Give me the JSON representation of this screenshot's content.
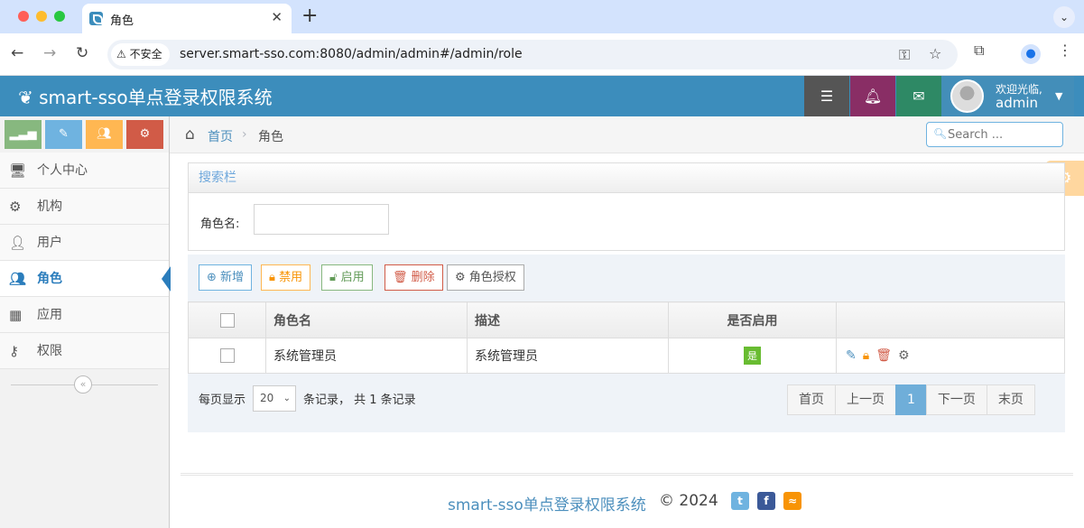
{
  "browser": {
    "tab_title": "角色",
    "tab_close": "✕",
    "new_tab": "+",
    "security_label": "不安全",
    "url": "server.smart-sso.com:8080/admin/admin#/admin/role"
  },
  "header": {
    "brand": "smart-sso单点登录权限系统",
    "welcome": "欢迎光临,",
    "username": "admin"
  },
  "sidebar": {
    "items": [
      {
        "label": "个人中心",
        "icon": "desktop-icon"
      },
      {
        "label": "机构",
        "icon": "gears-icon"
      },
      {
        "label": "用户",
        "icon": "user-icon"
      },
      {
        "label": "角色",
        "icon": "users-icon"
      },
      {
        "label": "应用",
        "icon": "th-large-icon"
      },
      {
        "label": "权限",
        "icon": "key-icon"
      }
    ],
    "active": "角色"
  },
  "breadcrumb": {
    "home": "首页",
    "current": "角色"
  },
  "search": {
    "placeholder": "Search ..."
  },
  "search_panel": {
    "title": "搜索栏",
    "role_name_label": "角色名:"
  },
  "actions": {
    "add": "新增",
    "disable": "禁用",
    "enable": "启用",
    "delete": "删除",
    "authorize": "角色授权"
  },
  "table": {
    "columns": [
      "角色名",
      "描述",
      "是否启用"
    ],
    "rows": [
      {
        "name": "系统管理员",
        "description": "系统管理员",
        "enabled": "是"
      }
    ]
  },
  "pagination": {
    "per_page_label": "每页显示",
    "per_page_value": "20",
    "summary": "条记录， 共 1 条记录",
    "first": "首页",
    "prev": "上一页",
    "current": "1",
    "next": "下一页",
    "last": "末页"
  },
  "footer": {
    "brand": "smart-sso单点登录权限系统",
    "copyright": "© 2024"
  },
  "colors": {
    "header": "#3c8dbc",
    "active_menu": "#2b7dbc",
    "enabled_badge": "#68bc31"
  }
}
